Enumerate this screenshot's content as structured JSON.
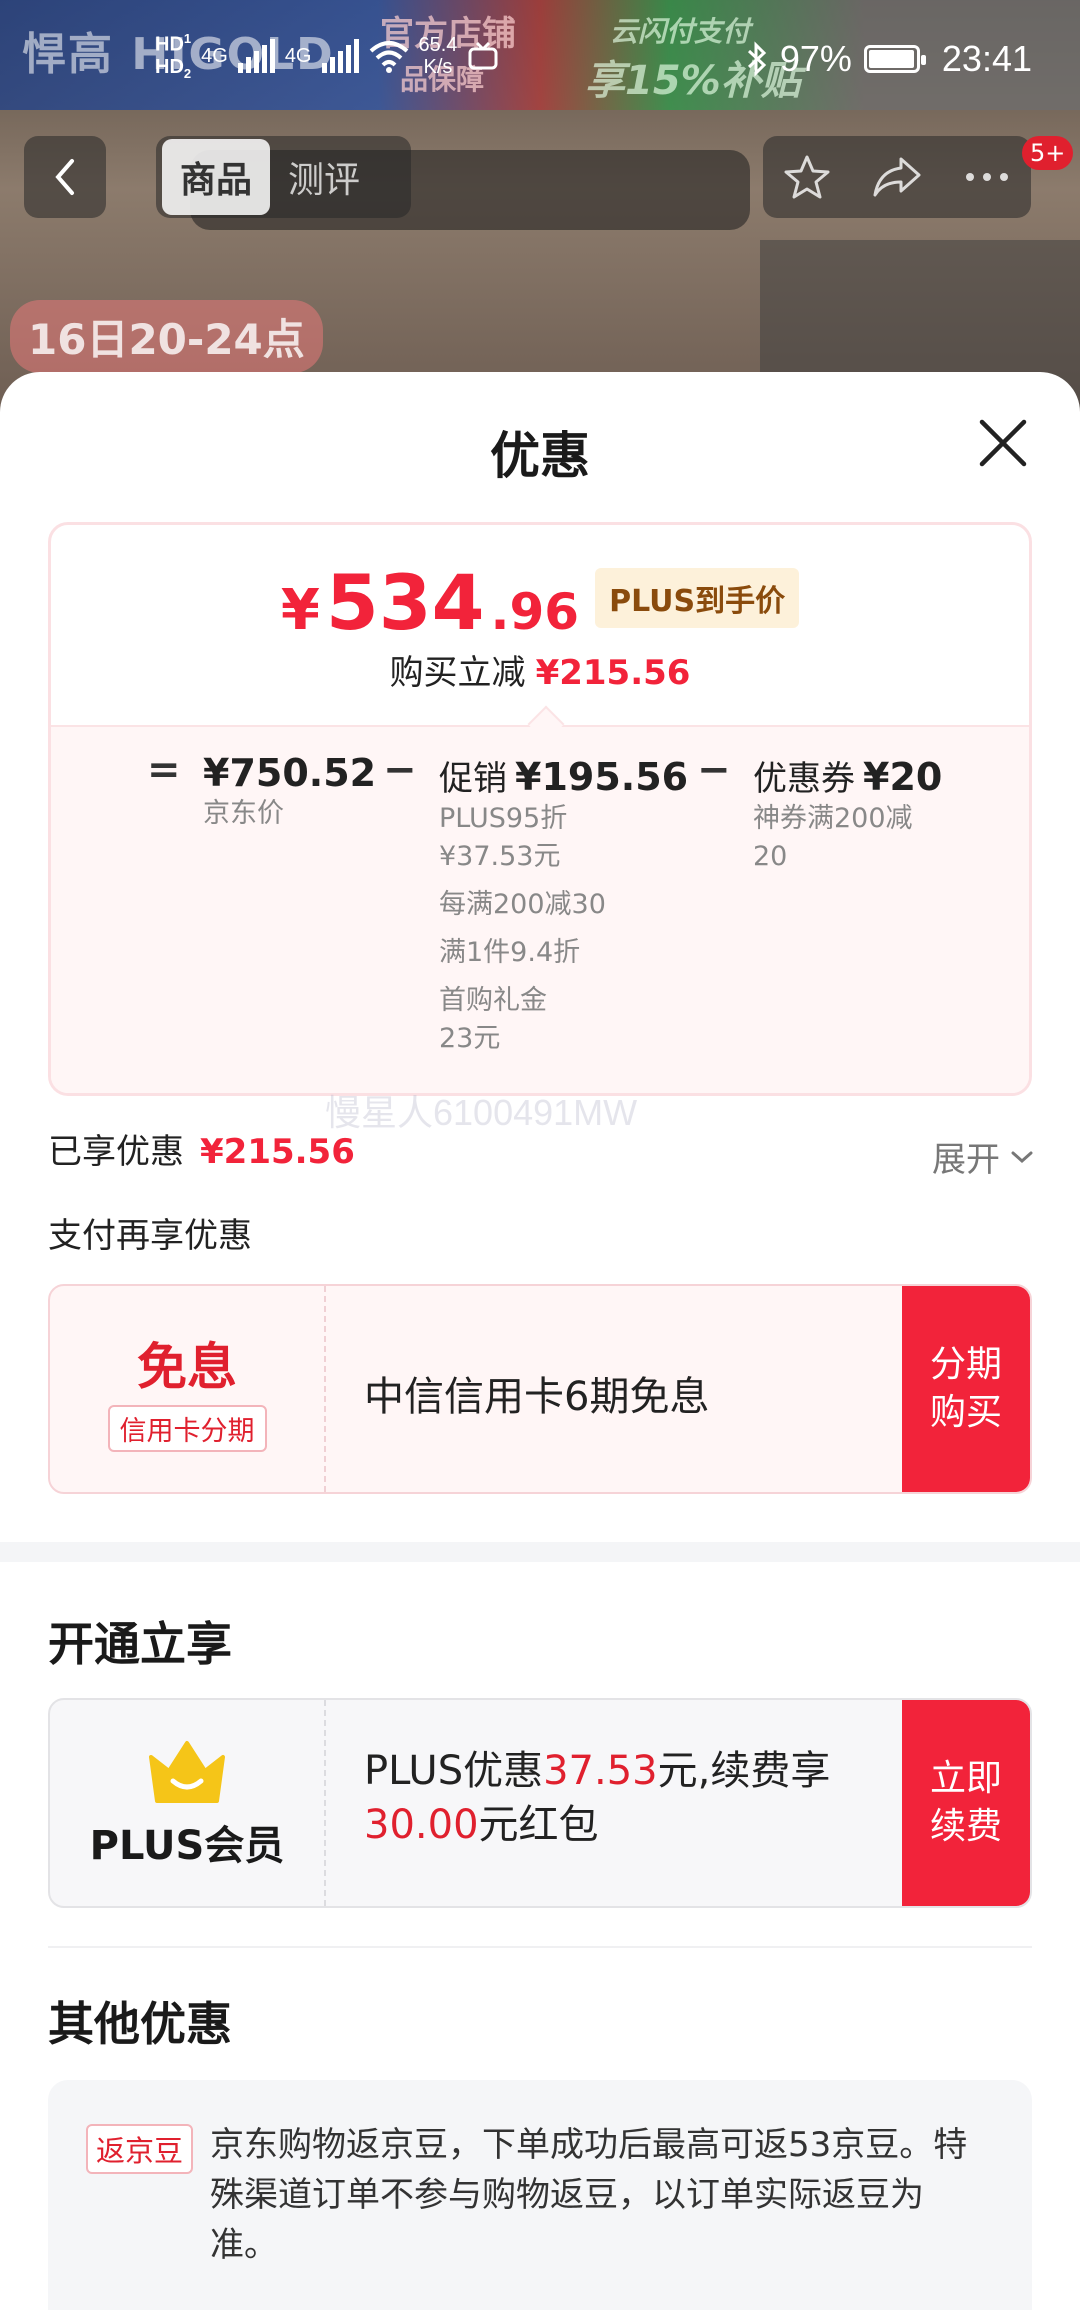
{
  "background": {
    "brand": "悍高",
    "banner_tag_1": "官方店铺",
    "banner_tag_1b": "品保障",
    "banner_tag_2": "云闪付支付",
    "banner_tag_2b": "享15%补贴",
    "promo": "16日20-24点"
  },
  "status_bar": {
    "hd1": "HD",
    "hd2": "HD",
    "net_4g_1": "4G",
    "net_4g_2": "4G",
    "speed_value": "65.4",
    "speed_unit": "K/s",
    "battery": "97%",
    "battery_level": 0.97,
    "time": "23:41"
  },
  "nav": {
    "tabs": [
      {
        "label": "商品"
      },
      {
        "label": "测评"
      }
    ],
    "badge": "5+"
  },
  "sheet": {
    "title": "优惠",
    "price_card": {
      "currency": "¥",
      "price_int": "534",
      "price_dec": ".96",
      "plus_tag": "PLUS到手价",
      "sub_label": "购买立减",
      "sub_value": "¥215.56",
      "op_equals": "=",
      "op_minus_1": "−",
      "op_minus_2": "−",
      "jd_price": "¥750.52",
      "jd_price_label": "京东价",
      "promo_label": "促销",
      "promo_value": "¥195.56",
      "promo_details": [
        "PLUS95折",
        "¥37.53元",
        "每满200减30",
        "满1件9.4折",
        "首购礼金",
        "23元"
      ],
      "coupon_label": "优惠券",
      "coupon_value": "¥20",
      "coupon_details": [
        "神券满200减",
        "20"
      ]
    },
    "watermark": "慢星人6100491MW",
    "enjoyed_label": "已享优惠",
    "enjoyed_value": "¥215.56",
    "expand_label": "展开",
    "pay_more_label": "支付再享优惠",
    "installment": {
      "main": "免息",
      "tag": "信用卡分期",
      "desc": "中信信用卡6期免息",
      "button_line1": "分期",
      "button_line2": "购买"
    },
    "open_section_title": "开通立享",
    "plus_member": {
      "name": "PLUS会员",
      "desc_part1": "PLUS优惠",
      "desc_amount1": "37.53",
      "desc_part2": "元,续费享",
      "desc_amount2": "30.00",
      "desc_part3": "元红包",
      "button_line1": "立即",
      "button_line2": "续费"
    },
    "other_section_title": "其他优惠",
    "other": {
      "tag": "返京豆",
      "text": "京东购物返京豆，下单成功后最高可返53京豆。特殊渠道订单不参与购物返豆，以订单实际返豆为准。"
    }
  },
  "colors": {
    "accent_red": "#f2233a",
    "plus_gold": "#f5c518",
    "plus_tag_bg": "#fdf1da"
  }
}
